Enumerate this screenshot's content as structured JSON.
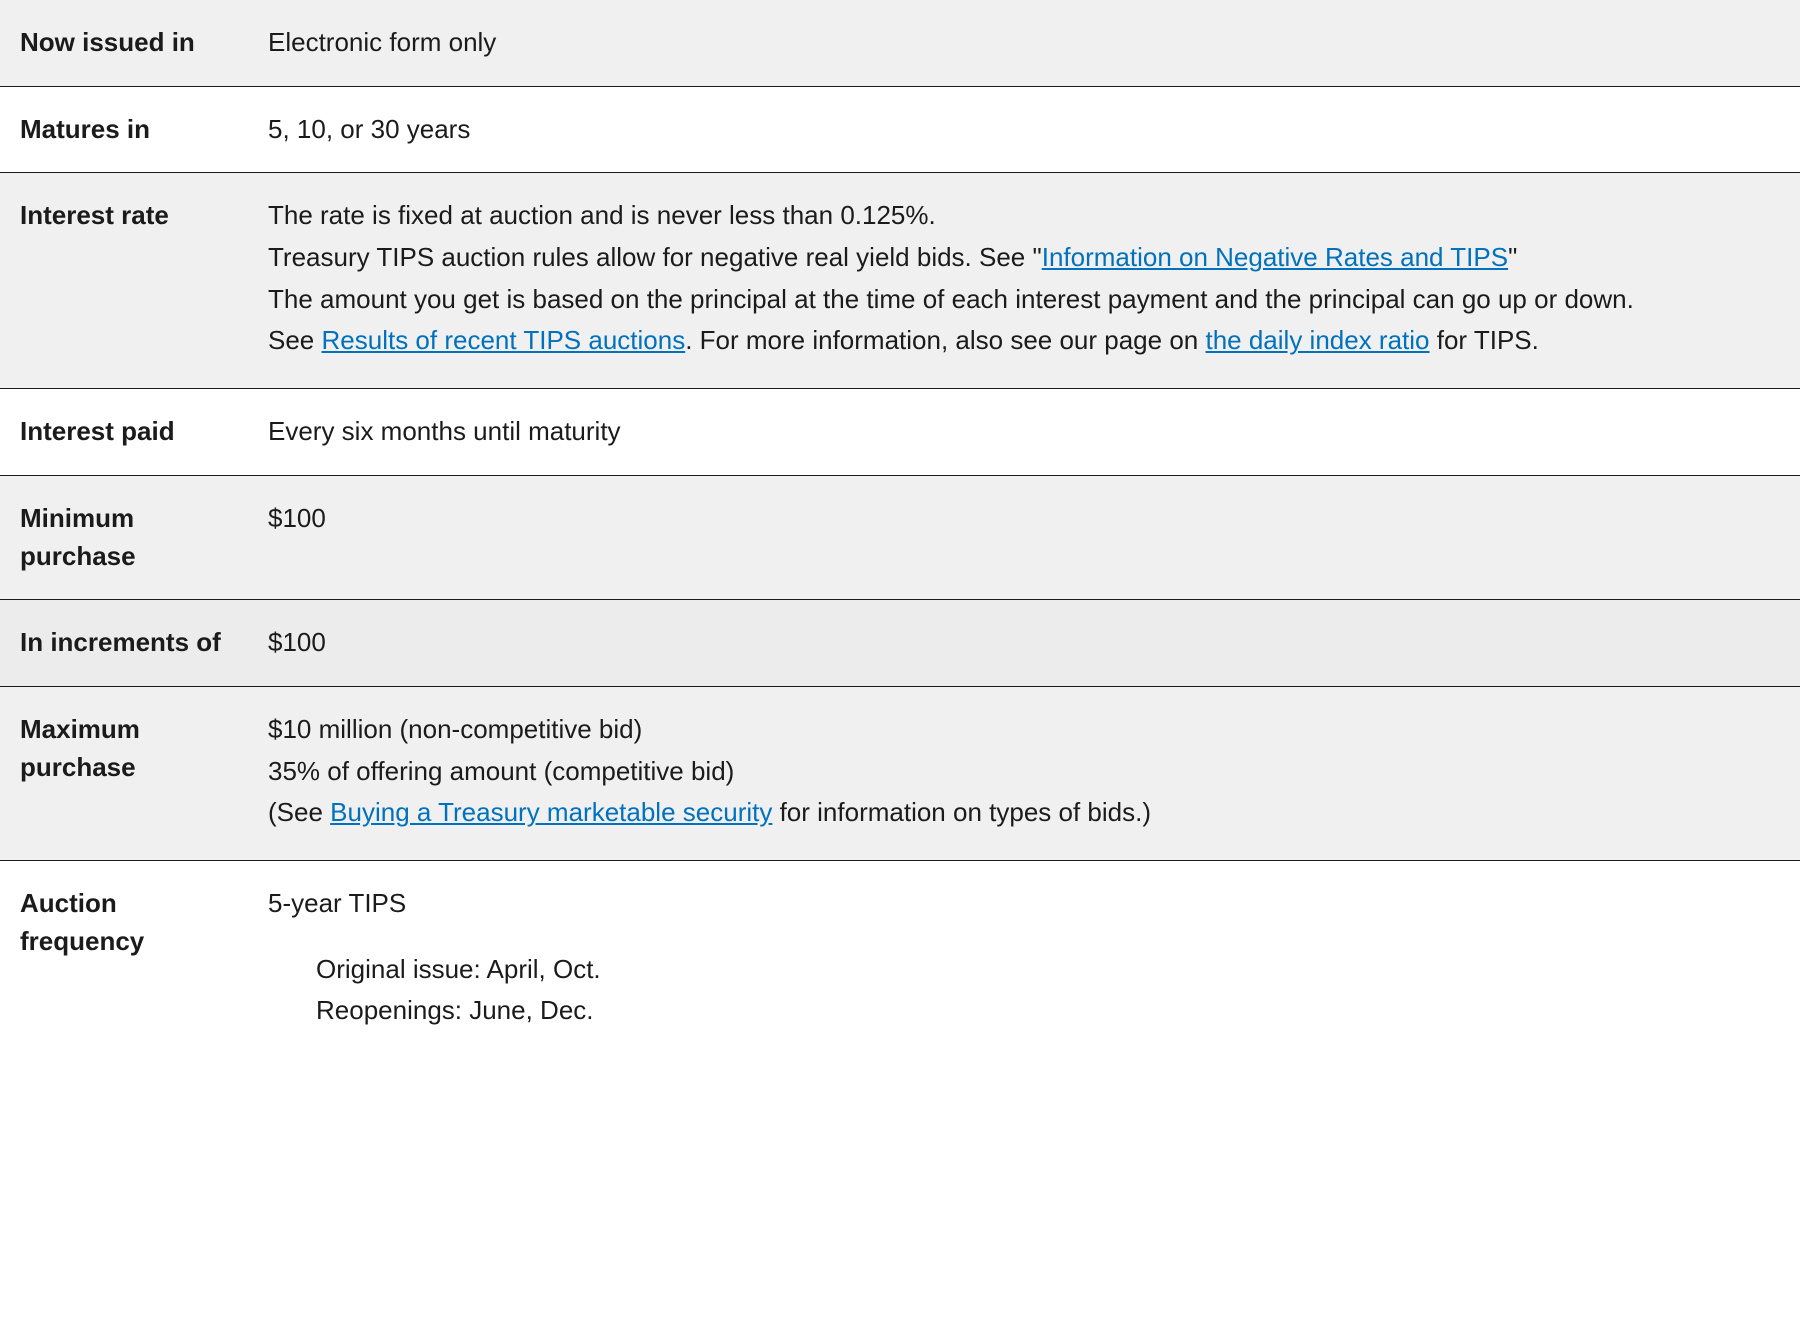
{
  "rows": {
    "now_issued": {
      "label": "Now issued in",
      "value": "Electronic form only"
    },
    "matures": {
      "label": "Matures in",
      "value": "5, 10, or 30 years"
    },
    "interest_rate": {
      "label": "Interest rate",
      "line1": "The rate is fixed at auction and is never less than 0.125%.",
      "line2a": "Treasury TIPS auction rules allow for negative real yield bids. See \"",
      "link1": "Information on Negative Rates and TIPS",
      "line2b": "\"",
      "line3": "The amount you get is based on the principal at the time of each interest payment and the principal can go up or down.",
      "line4a": "See ",
      "link2": "Results of recent TIPS auctions",
      "line4b": ". For more information, also see our page on ",
      "link3": "the daily index ratio",
      "line4c": " for TIPS."
    },
    "interest_paid": {
      "label": "Interest paid",
      "value": "Every six months until maturity"
    },
    "min_purchase": {
      "label": "Minimum purchase",
      "value": "$100"
    },
    "increments": {
      "label": "In increments of",
      "value": "$100"
    },
    "max_purchase": {
      "label": "Maximum purchase",
      "line1": "$10 million (non-competitive bid)",
      "line2": "35% of offering amount (competitive bid)",
      "line3a": "(See ",
      "link1": "Buying a Treasury marketable security",
      "line3b": " for information on types of bids.)"
    },
    "auction_freq": {
      "label": "Auction frequency",
      "heading1": "5-year TIPS",
      "orig1": "Original issue: April, Oct.",
      "reop1": "Reopenings: June, Dec."
    }
  }
}
